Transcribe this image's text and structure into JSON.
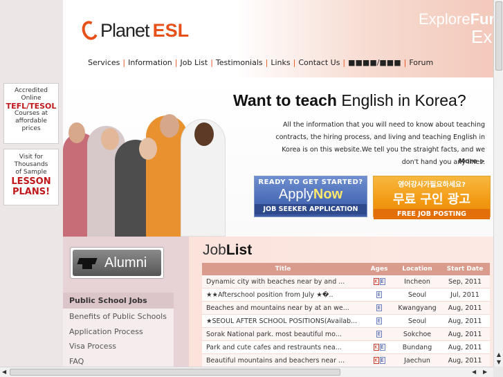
{
  "header": {
    "logo_planet": "Planet",
    "logo_esl": "ESL",
    "tagline_light": "Explore",
    "tagline_bold": "Furt",
    "tagline2": "Exp",
    "nav": [
      "Services",
      "Information",
      "Job List",
      "Testimonials",
      "Links",
      "Contact Us"
    ],
    "nav_korean": "■■■■/■■■",
    "nav_forum": "Forum"
  },
  "left_ads": {
    "ad1": {
      "line1": "Accredited",
      "line2": "Online",
      "highlight": "TEFL/TESOL",
      "line3": "Courses at",
      "line4": "affordable",
      "line5": "prices"
    },
    "ad2": {
      "line1": "Visit for",
      "line2": "Thousands",
      "line3": "of Sample",
      "highlight1": "LESSON",
      "highlight2": "PLANS!"
    }
  },
  "hero": {
    "title_bold": "Want to teach",
    "title_rest": "English in Korea?",
    "text": "All the information that you will need to know about teaching contracts, the hiring process, and living and teaching English in Korea is on this website.We tell you the straight facts, and we don't hand you any lines.",
    "more": "More >",
    "apply": {
      "top": "READY TO GET STARTED?",
      "apply": "Apply",
      "now": "Now",
      "bottom": "JOB SEEKER APPLICATION"
    },
    "post": {
      "top": "영어강사가필요하세요?",
      "main": "무료 구인 광고",
      "bottom": "FREE JOB POSTING"
    }
  },
  "alumni": {
    "label": "Alumni"
  },
  "side_menu": {
    "heading": "Public School Jobs",
    "items": [
      "Benefits of Public Schools",
      "Application Process",
      "Visa Process",
      "FAQ"
    ]
  },
  "joblist": {
    "title_light": "Job",
    "title_bold": "List",
    "columns": [
      "Title",
      "Ages",
      "Location",
      "Start Date"
    ],
    "rows": [
      {
        "title": "Dynamic city with beaches near by and ...",
        "ages": [
          "K",
          "E"
        ],
        "location": "Incheon",
        "start": "Sep, 2011"
      },
      {
        "title": "★★Afterschool position from July ★�..",
        "ages": [
          "E"
        ],
        "location": "Seoul",
        "start": "Jul, 2011"
      },
      {
        "title": "Beaches and mountains near by at an we...",
        "ages": [
          "E"
        ],
        "location": "Kwangyang",
        "start": "Aug, 2011"
      },
      {
        "title": "★SEOUL AFTER SCHOOL POSITIONS(Availab...",
        "ages": [
          "E"
        ],
        "location": "Seoul",
        "start": "Aug, 2011"
      },
      {
        "title": "Sorak National park. most beautiful mo...",
        "ages": [
          "E"
        ],
        "location": "Sokchoe",
        "start": "Aug, 2011"
      },
      {
        "title": "Park and cute cafes and restraunts nea...",
        "ages": [
          "K",
          "E"
        ],
        "location": "Bundang",
        "start": "Aug, 2011"
      },
      {
        "title": "Beautiful mountains and beachers near ...",
        "ages": [
          "K",
          "E"
        ],
        "location": "Jaechun",
        "start": "Aug, 2011"
      }
    ]
  },
  "colors": {
    "accent": "#e8501a",
    "table_header": "#d99b8c",
    "apply_blue": "#4b6cb7",
    "post_orange": "#f39a14"
  }
}
